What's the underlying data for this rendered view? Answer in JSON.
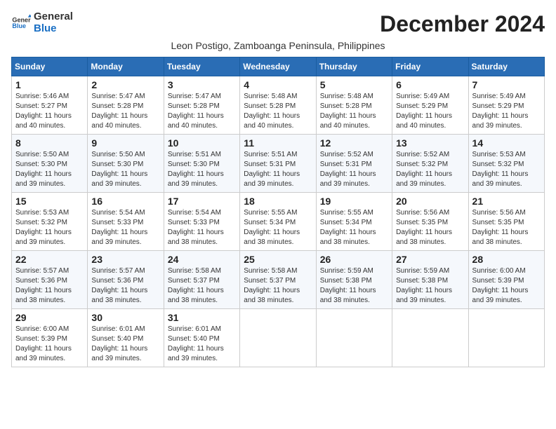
{
  "logo": {
    "line1": "General",
    "line2": "Blue"
  },
  "title": "December 2024",
  "subtitle": "Leon Postigo, Zamboanga Peninsula, Philippines",
  "weekdays": [
    "Sunday",
    "Monday",
    "Tuesday",
    "Wednesday",
    "Thursday",
    "Friday",
    "Saturday"
  ],
  "weeks": [
    [
      {
        "day": "1",
        "info": "Sunrise: 5:46 AM\nSunset: 5:27 PM\nDaylight: 11 hours\nand 40 minutes."
      },
      {
        "day": "2",
        "info": "Sunrise: 5:47 AM\nSunset: 5:28 PM\nDaylight: 11 hours\nand 40 minutes."
      },
      {
        "day": "3",
        "info": "Sunrise: 5:47 AM\nSunset: 5:28 PM\nDaylight: 11 hours\nand 40 minutes."
      },
      {
        "day": "4",
        "info": "Sunrise: 5:48 AM\nSunset: 5:28 PM\nDaylight: 11 hours\nand 40 minutes."
      },
      {
        "day": "5",
        "info": "Sunrise: 5:48 AM\nSunset: 5:28 PM\nDaylight: 11 hours\nand 40 minutes."
      },
      {
        "day": "6",
        "info": "Sunrise: 5:49 AM\nSunset: 5:29 PM\nDaylight: 11 hours\nand 40 minutes."
      },
      {
        "day": "7",
        "info": "Sunrise: 5:49 AM\nSunset: 5:29 PM\nDaylight: 11 hours\nand 39 minutes."
      }
    ],
    [
      {
        "day": "8",
        "info": "Sunrise: 5:50 AM\nSunset: 5:30 PM\nDaylight: 11 hours\nand 39 minutes."
      },
      {
        "day": "9",
        "info": "Sunrise: 5:50 AM\nSunset: 5:30 PM\nDaylight: 11 hours\nand 39 minutes."
      },
      {
        "day": "10",
        "info": "Sunrise: 5:51 AM\nSunset: 5:30 PM\nDaylight: 11 hours\nand 39 minutes."
      },
      {
        "day": "11",
        "info": "Sunrise: 5:51 AM\nSunset: 5:31 PM\nDaylight: 11 hours\nand 39 minutes."
      },
      {
        "day": "12",
        "info": "Sunrise: 5:52 AM\nSunset: 5:31 PM\nDaylight: 11 hours\nand 39 minutes."
      },
      {
        "day": "13",
        "info": "Sunrise: 5:52 AM\nSunset: 5:32 PM\nDaylight: 11 hours\nand 39 minutes."
      },
      {
        "day": "14",
        "info": "Sunrise: 5:53 AM\nSunset: 5:32 PM\nDaylight: 11 hours\nand 39 minutes."
      }
    ],
    [
      {
        "day": "15",
        "info": "Sunrise: 5:53 AM\nSunset: 5:32 PM\nDaylight: 11 hours\nand 39 minutes."
      },
      {
        "day": "16",
        "info": "Sunrise: 5:54 AM\nSunset: 5:33 PM\nDaylight: 11 hours\nand 39 minutes."
      },
      {
        "day": "17",
        "info": "Sunrise: 5:54 AM\nSunset: 5:33 PM\nDaylight: 11 hours\nand 38 minutes."
      },
      {
        "day": "18",
        "info": "Sunrise: 5:55 AM\nSunset: 5:34 PM\nDaylight: 11 hours\nand 38 minutes."
      },
      {
        "day": "19",
        "info": "Sunrise: 5:55 AM\nSunset: 5:34 PM\nDaylight: 11 hours\nand 38 minutes."
      },
      {
        "day": "20",
        "info": "Sunrise: 5:56 AM\nSunset: 5:35 PM\nDaylight: 11 hours\nand 38 minutes."
      },
      {
        "day": "21",
        "info": "Sunrise: 5:56 AM\nSunset: 5:35 PM\nDaylight: 11 hours\nand 38 minutes."
      }
    ],
    [
      {
        "day": "22",
        "info": "Sunrise: 5:57 AM\nSunset: 5:36 PM\nDaylight: 11 hours\nand 38 minutes."
      },
      {
        "day": "23",
        "info": "Sunrise: 5:57 AM\nSunset: 5:36 PM\nDaylight: 11 hours\nand 38 minutes."
      },
      {
        "day": "24",
        "info": "Sunrise: 5:58 AM\nSunset: 5:37 PM\nDaylight: 11 hours\nand 38 minutes."
      },
      {
        "day": "25",
        "info": "Sunrise: 5:58 AM\nSunset: 5:37 PM\nDaylight: 11 hours\nand 38 minutes."
      },
      {
        "day": "26",
        "info": "Sunrise: 5:59 AM\nSunset: 5:38 PM\nDaylight: 11 hours\nand 38 minutes."
      },
      {
        "day": "27",
        "info": "Sunrise: 5:59 AM\nSunset: 5:38 PM\nDaylight: 11 hours\nand 39 minutes."
      },
      {
        "day": "28",
        "info": "Sunrise: 6:00 AM\nSunset: 5:39 PM\nDaylight: 11 hours\nand 39 minutes."
      }
    ],
    [
      {
        "day": "29",
        "info": "Sunrise: 6:00 AM\nSunset: 5:39 PM\nDaylight: 11 hours\nand 39 minutes."
      },
      {
        "day": "30",
        "info": "Sunrise: 6:01 AM\nSunset: 5:40 PM\nDaylight: 11 hours\nand 39 minutes."
      },
      {
        "day": "31",
        "info": "Sunrise: 6:01 AM\nSunset: 5:40 PM\nDaylight: 11 hours\nand 39 minutes."
      },
      {
        "day": "",
        "info": ""
      },
      {
        "day": "",
        "info": ""
      },
      {
        "day": "",
        "info": ""
      },
      {
        "day": "",
        "info": ""
      }
    ]
  ]
}
